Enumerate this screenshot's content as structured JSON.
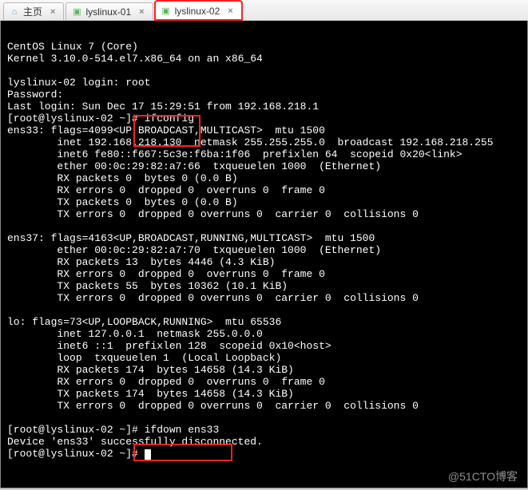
{
  "tabs": [
    {
      "label": "主页",
      "icon": "home",
      "active": false,
      "highlighted": false
    },
    {
      "label": "lyslinux-01",
      "icon": "term",
      "active": false,
      "highlighted": false
    },
    {
      "label": "lyslinux-02",
      "icon": "term",
      "active": true,
      "highlighted": true
    }
  ],
  "terminal": {
    "header1": "CentOS Linux 7 (Core)",
    "header2": "Kernel 3.10.0-514.el7.x86_64 on an x86_64",
    "blank": "",
    "login_prompt": "lyslinux-02 login: root",
    "password_prompt": "Password:",
    "last_login": "Last login: Sun Dec 17 15:29:51 from 192.168.218.1",
    "prompt1": "[root@lyslinux-02 ~]# ifconfig",
    "ens33_head": "ens33: flags=4099<UP,BROADCAST,MULTICAST>  mtu 1500",
    "ens33_inet": "        inet 192.168.218.130  netmask 255.255.255.0  broadcast 192.168.218.255",
    "ens33_inet6": "        inet6 fe80::f667:5c3e:f6ba:1f06  prefixlen 64  scopeid 0x20<link>",
    "ens33_ether": "        ether 00:0c:29:82:a7:66  txqueuelen 1000  (Ethernet)",
    "ens33_rxp": "        RX packets 0  bytes 0 (0.0 B)",
    "ens33_rxe": "        RX errors 0  dropped 0  overruns 0  frame 0",
    "ens33_txp": "        TX packets 0  bytes 0 (0.0 B)",
    "ens33_txe": "        TX errors 0  dropped 0 overruns 0  carrier 0  collisions 0",
    "ens37_head": "ens37: flags=4163<UP,BROADCAST,RUNNING,MULTICAST>  mtu 1500",
    "ens37_ether": "        ether 00:0c:29:82:a7:70  txqueuelen 1000  (Ethernet)",
    "ens37_rxp": "        RX packets 13  bytes 4446 (4.3 KiB)",
    "ens37_rxe": "        RX errors 0  dropped 0  overruns 0  frame 0",
    "ens37_txp": "        TX packets 55  bytes 10362 (10.1 KiB)",
    "ens37_txe": "        TX errors 0  dropped 0 overruns 0  carrier 0  collisions 0",
    "lo_head": "lo: flags=73<UP,LOOPBACK,RUNNING>  mtu 65536",
    "lo_inet": "        inet 127.0.0.1  netmask 255.0.0.0",
    "lo_inet6": "        inet6 ::1  prefixlen 128  scopeid 0x10<host>",
    "lo_loop": "        loop  txqueuelen 1  (Local Loopback)",
    "lo_rxp": "        RX packets 174  bytes 14658 (14.3 KiB)",
    "lo_rxe": "        RX errors 0  dropped 0  overruns 0  frame 0",
    "lo_txp": "        TX packets 174  bytes 14658 (14.3 KiB)",
    "lo_txe": "        TX errors 0  dropped 0 overruns 0  carrier 0  collisions 0",
    "prompt2": "[root@lyslinux-02 ~]# ifdown ens33",
    "disconnect": "Device 'ens33' successfully disconnected.",
    "prompt3": "[root@lyslinux-02 ~]# "
  },
  "watermark": "@51CTO博客"
}
